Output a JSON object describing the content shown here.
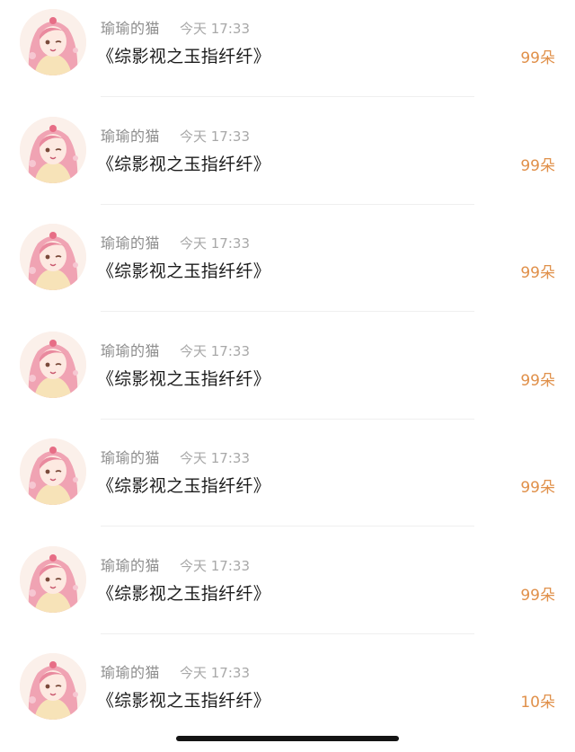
{
  "feed": {
    "items": [
      {
        "username": "瑜瑜的猫",
        "time": "今天 17:33",
        "title": "《综影视之玉指纤纤》",
        "gift": "99朵"
      },
      {
        "username": "瑜瑜的猫",
        "time": "今天 17:33",
        "title": "《综影视之玉指纤纤》",
        "gift": "99朵"
      },
      {
        "username": "瑜瑜的猫",
        "time": "今天 17:33",
        "title": "《综影视之玉指纤纤》",
        "gift": "99朵"
      },
      {
        "username": "瑜瑜的猫",
        "time": "今天 17:33",
        "title": "《综影视之玉指纤纤》",
        "gift": "99朵"
      },
      {
        "username": "瑜瑜的猫",
        "time": "今天 17:33",
        "title": "《综影视之玉指纤纤》",
        "gift": "99朵"
      },
      {
        "username": "瑜瑜的猫",
        "time": "今天 17:33",
        "title": "《综影视之玉指纤纤》",
        "gift": "99朵"
      },
      {
        "username": "瑜瑜的猫",
        "time": "今天 17:33",
        "title": "《综影视之玉指纤纤》",
        "gift": "10朵"
      }
    ],
    "avatar_image": "anime-girl-avatar",
    "gift_color": "#e0904a"
  },
  "system": {
    "home_indicator": "home-indicator-bar"
  }
}
